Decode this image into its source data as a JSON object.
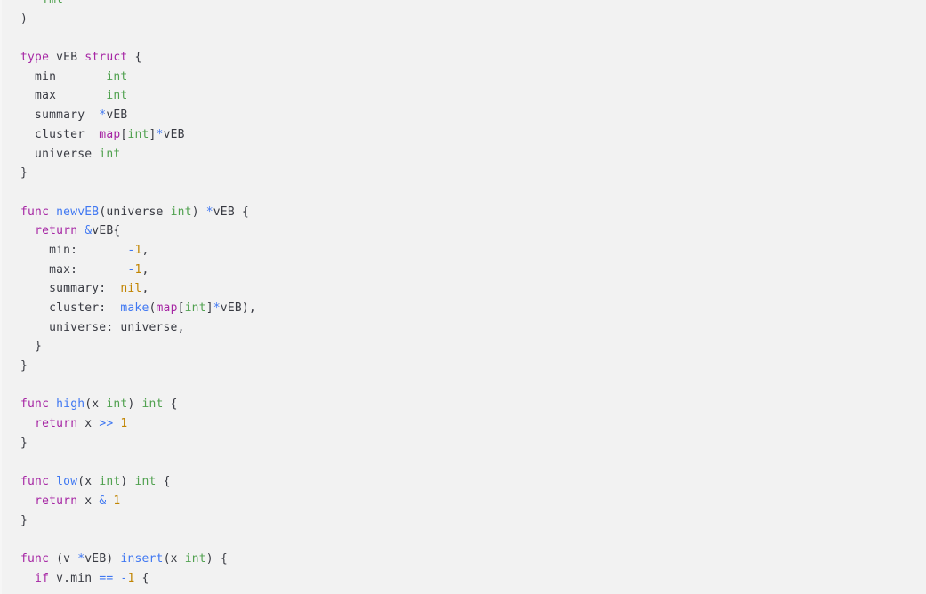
{
  "editor": {
    "language": "go",
    "background_color": "#f2f2f2",
    "font_size_px": 13,
    "line_height_px": 21.7,
    "theme": "light",
    "scroll_clipped_top": true
  },
  "colors": {
    "background": "#f2f2f2",
    "plain_text": "#383a42",
    "keyword": "#a626a4",
    "function": "#4078f2",
    "type": "#50a14f",
    "string": "#50a14f",
    "number": "#c18401",
    "constant": "#c18401",
    "operator": "#4078f2",
    "punctuation": "#383a42"
  },
  "code": {
    "lines": [
      "  \"fmt\"",
      ")",
      "",
      "type vEB struct {",
      "  min       int",
      "  max       int",
      "  summary  *vEB",
      "  cluster  map[int]*vEB",
      "  universe int",
      "}",
      "",
      "func newvEB(universe int) *vEB {",
      "  return &vEB{",
      "    min:       -1,",
      "    max:       -1,",
      "    summary:  nil,",
      "    cluster:  make(map[int]*vEB),",
      "    universe: universe,",
      "  }",
      "}",
      "",
      "func high(x int) int {",
      "  return x >> 1",
      "}",
      "",
      "func low(x int) int {",
      "  return x & 1",
      "}",
      "",
      "func (v *vEB) insert(x int) {",
      "  if v.min == -1 {"
    ]
  }
}
